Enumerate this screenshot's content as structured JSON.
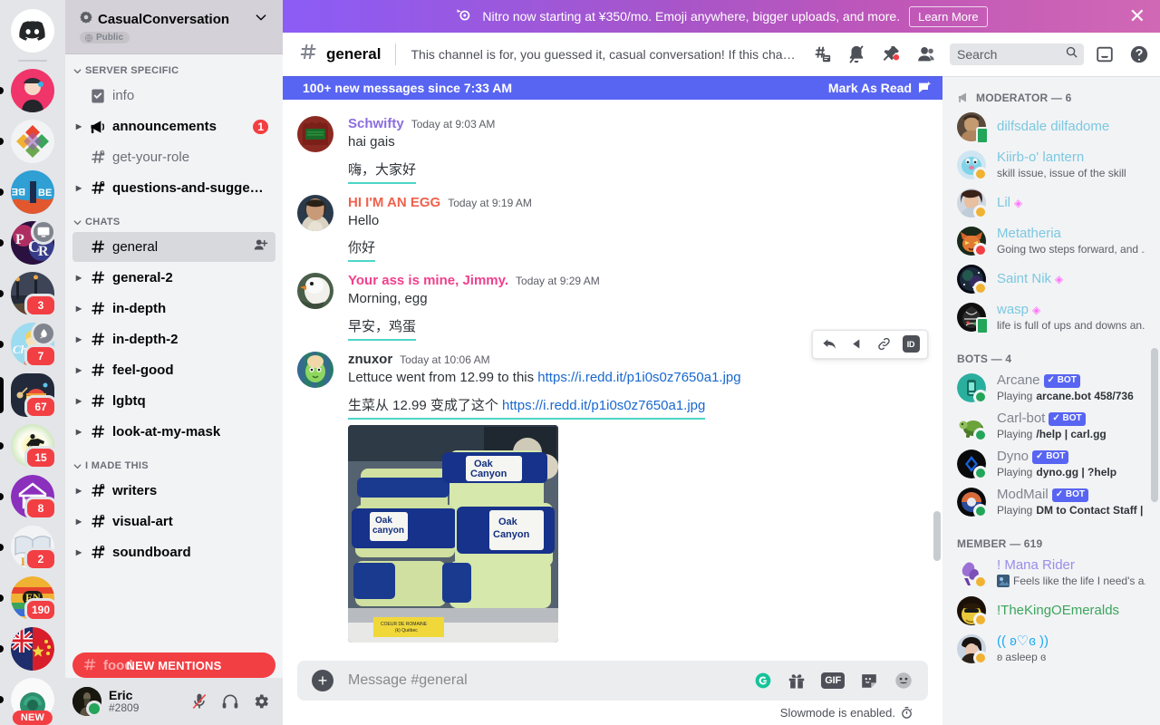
{
  "nitro_banner": {
    "text": "Nitro now starting at ¥350/mo. Emoji anywhere, bigger uploads, and more.",
    "button": "Learn More",
    "close": "✕",
    "icon": "nitro-icon"
  },
  "server_rail": {
    "home_label": "Discord",
    "servers": [
      {
        "name": "gremlin-server",
        "badge": "",
        "mini": "",
        "active": false,
        "pill": "dot"
      },
      {
        "name": "kde-server",
        "badge": "",
        "mini": "",
        "active": false,
        "pill": "dot"
      },
      {
        "name": "benzene-server",
        "badge": "",
        "mini": "",
        "active": false,
        "pill": "dot"
      },
      {
        "name": "pcr-server",
        "badge": "",
        "mini": "screen",
        "active": false,
        "pill": "dot"
      },
      {
        "name": "night-street-server",
        "badge": "3",
        "mini": "",
        "active": false,
        "pill": "dot"
      },
      {
        "name": "chillbar-server",
        "badge": "7",
        "mini": "boost",
        "active": false,
        "pill": "dot"
      },
      {
        "name": "pride-server",
        "badge": "67",
        "mini": "",
        "active": true,
        "pill": "tall"
      },
      {
        "name": "runner-server",
        "badge": "15",
        "mini": "",
        "active": false,
        "pill": "dot"
      },
      {
        "name": "ieh-server",
        "badge": "8",
        "mini": "",
        "active": false,
        "pill": "dot"
      },
      {
        "name": "py-book-server",
        "badge": "2",
        "mini": "",
        "active": false,
        "pill": "dot"
      },
      {
        "name": "en-server",
        "badge": "190",
        "mini": "",
        "active": false,
        "pill": "dot"
      },
      {
        "name": "uk-cn-flag-server",
        "badge": "",
        "mini": "",
        "active": false,
        "pill": "dot"
      },
      {
        "name": "new-server",
        "badge": "NEW",
        "mini": "",
        "active": false,
        "pill": "dot"
      }
    ]
  },
  "sidebar": {
    "guild_name": "CasualConversation",
    "guild_badge": "Public",
    "categories": [
      {
        "label": "SERVER SPECIFIC",
        "channels": [
          {
            "name": "info",
            "icon": "rules-icon",
            "unread": false,
            "badge": "",
            "arrow": false,
            "active": false,
            "locked": false
          },
          {
            "name": "announcements",
            "icon": "announcement-icon",
            "unread": true,
            "badge": "1",
            "arrow": true,
            "active": false,
            "locked": false
          },
          {
            "name": "get-your-role",
            "icon": "hash-lock-icon",
            "unread": false,
            "badge": "",
            "arrow": false,
            "active": false,
            "locked": true
          },
          {
            "name": "questions-and-sugges...",
            "icon": "hash-lock-icon",
            "unread": true,
            "badge": "",
            "arrow": true,
            "active": false,
            "locked": true
          }
        ]
      },
      {
        "label": "CHATS",
        "channels": [
          {
            "name": "general",
            "icon": "hash-icon",
            "unread": false,
            "badge": "",
            "arrow": false,
            "active": true,
            "locked": false
          },
          {
            "name": "general-2",
            "icon": "hash-icon",
            "unread": true,
            "badge": "",
            "arrow": true,
            "active": false,
            "locked": false
          },
          {
            "name": "in-depth",
            "icon": "hash-icon",
            "unread": true,
            "badge": "",
            "arrow": true,
            "active": false,
            "locked": false
          },
          {
            "name": "in-depth-2",
            "icon": "hash-icon",
            "unread": true,
            "badge": "",
            "arrow": true,
            "active": false,
            "locked": false
          },
          {
            "name": "feel-good",
            "icon": "hash-icon",
            "unread": true,
            "badge": "",
            "arrow": true,
            "active": false,
            "locked": false
          },
          {
            "name": "lgbtq",
            "icon": "hash-icon",
            "unread": true,
            "badge": "",
            "arrow": true,
            "active": false,
            "locked": false
          },
          {
            "name": "look-at-my-mask",
            "icon": "hash-icon",
            "unread": true,
            "badge": "",
            "arrow": true,
            "active": false,
            "locked": false
          }
        ]
      },
      {
        "label": "I MADE THIS",
        "channels": [
          {
            "name": "writers",
            "icon": "hash-lock-icon",
            "unread": true,
            "badge": "",
            "arrow": true,
            "active": false,
            "locked": true
          },
          {
            "name": "visual-art",
            "icon": "hash-lock-icon",
            "unread": true,
            "badge": "",
            "arrow": true,
            "active": false,
            "locked": true
          },
          {
            "name": "soundboard",
            "icon": "hash-lock-icon",
            "unread": true,
            "badge": "",
            "arrow": true,
            "active": false,
            "locked": true
          }
        ]
      }
    ],
    "hidden_channel": "food",
    "new_mentions_banner": "NEW MENTIONS",
    "user": {
      "name": "Eric",
      "tag": "#2809",
      "status": "online",
      "mute_icon": "mic-muted-icon",
      "deafen_icon": "headphones-icon",
      "settings_icon": "gear-icon"
    }
  },
  "channel_header": {
    "hash": "#",
    "title": "general",
    "topic": "This channel is for, you guessed it, casual conversation! If this chann...",
    "icons": [
      "threads-icon",
      "bell-muted-icon",
      "pin-icon",
      "members-icon"
    ],
    "search_placeholder": "Search",
    "search_value": "",
    "inbox_icon": "inbox-icon",
    "help_icon": "help-icon"
  },
  "chat": {
    "new_messages_bar": "100+ new messages since 7:33 AM",
    "mark_as_read": "Mark As Read",
    "messages": [
      {
        "author": "Schwifty",
        "author_color": "#8b6ddf",
        "timestamp": "Today at 9:03 AM",
        "text": "hai gais",
        "translation": "嗨，大家好",
        "avatar": "schwifty-avatar"
      },
      {
        "author": "HI I'M AN EGG",
        "author_color": "#f0614d",
        "timestamp": "Today at 9:19 AM",
        "text": "Hello",
        "translation": "你好",
        "avatar": "egg-avatar"
      },
      {
        "author": "Your ass is mine, Jimmy.",
        "author_color": "#f0408c",
        "timestamp": "Today at 9:29 AM",
        "text": "Morning, egg",
        "translation": "早安，鸡蛋",
        "avatar": "goose-avatar"
      },
      {
        "author": "znuxor",
        "author_color": "#2e3338",
        "timestamp": "Today at 10:06 AM",
        "text_prefix": "Lettuce went from 12.99 to this ",
        "link": "https://i.redd.it/p1i0s0z7650a1.jpg",
        "translation_prefix": "生菜从 12.99 变成了这个 ",
        "translation_link": "https://i.redd.it/p1i0s0z7650a1.jpg",
        "avatar": "znuxor-avatar",
        "image_alt": "oak-canyon-lettuce-photo",
        "image_caption": "COEUR DE ROMAINE"
      }
    ],
    "hover_actions": [
      "reply-icon",
      "react-icon",
      "link-icon",
      "copy-id-icon"
    ],
    "hover_id_label": "ID"
  },
  "composer": {
    "placeholder": "Message #general",
    "value": "",
    "plus_icon": "add-attachment-icon",
    "grammarly_icon": "grammarly-icon",
    "gift_icon": "gift-icon",
    "gif_label": "GIF",
    "sticker_icon": "sticker-icon",
    "emoji_icon": "emoji-icon",
    "slowmode": "Slowmode is enabled.",
    "slowmode_icon": "timer-icon"
  },
  "members": {
    "groups": [
      {
        "label": "MODERATOR — 6",
        "icon": "megaphone-icon",
        "people": [
          {
            "name": "dilfsdale dilfadome",
            "color": "#7bc8e0",
            "status": "mobile",
            "sub": "",
            "avatar": "dilfsdale-avatar",
            "boost": false
          },
          {
            "name": "Kiirb-o' lantern",
            "color": "#7bc8e0",
            "status": "idle",
            "sub": "skill issue, issue of the skill",
            "avatar": "kiirb-avatar",
            "boost": false
          },
          {
            "name": "Lil",
            "color": "#7bc8e0",
            "status": "idle",
            "sub": "",
            "avatar": "lil-avatar",
            "boost": true
          },
          {
            "name": "Metatheria",
            "color": "#7bc8e0",
            "status": "dnd",
            "sub": "Going two steps forward, and ...",
            "avatar": "metatheria-avatar",
            "boost": false
          },
          {
            "name": "Saint Nik",
            "color": "#7bc8e0",
            "status": "idle",
            "sub": "",
            "avatar": "saintnik-avatar",
            "boost": true
          },
          {
            "name": "wasp",
            "color": "#7bc8e0",
            "status": "mobile",
            "sub": "life is full of ups and downs an...",
            "avatar": "wasp-avatar",
            "boost": true
          }
        ]
      },
      {
        "label": "BOTS — 4",
        "icon": "",
        "people": [
          {
            "name": "Arcane",
            "color": "#80848e",
            "status": "online",
            "sub_prefix": "Playing ",
            "sub_bold": "arcane.bot 458/736",
            "avatar": "arcane-avatar",
            "bot": true
          },
          {
            "name": "Carl-bot",
            "color": "#80848e",
            "status": "online",
            "sub_prefix": "Playing ",
            "sub_bold": "/help | carl.gg",
            "avatar": "carlbot-avatar",
            "bot": true
          },
          {
            "name": "Dyno",
            "color": "#80848e",
            "status": "online",
            "sub_prefix": "Playing ",
            "sub_bold": "dyno.gg | ?help",
            "avatar": "dyno-avatar",
            "bot": true
          },
          {
            "name": "ModMail",
            "color": "#80848e",
            "status": "online",
            "sub_prefix": "Playing ",
            "sub_bold": "DM to Contact Staff | ...",
            "avatar": "modmail-avatar",
            "bot": true
          }
        ]
      },
      {
        "label": "MEMBER — 619",
        "icon": "",
        "people": [
          {
            "name": "! Mana Rider",
            "color": "#9b8ce8",
            "status": "idle",
            "sub": "Feels like the life I need's a...",
            "sub_emoji": true,
            "avatar": "manarider-avatar",
            "boost": false
          },
          {
            "name": "!TheKingOEmeralds",
            "color": "#3ba55c",
            "status": "idle",
            "sub": "",
            "avatar": "kingo-avatar",
            "boost": false
          },
          {
            "name": "(( ʚ♡ɞ ))",
            "color": "#1eaaf1",
            "status": "idle",
            "sub": "ʚ asleep ɞ",
            "avatar": "cute-avatar",
            "boost": false
          }
        ]
      }
    ],
    "bot_tag": "BOT"
  }
}
